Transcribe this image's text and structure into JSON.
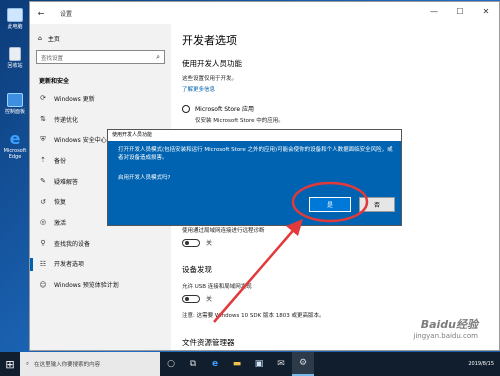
{
  "desktop": {
    "icons": [
      {
        "label": "此电脑"
      },
      {
        "label": "回收站"
      },
      {
        "label": "控制面板"
      },
      {
        "label": "Microsoft Edge"
      }
    ]
  },
  "window": {
    "title": "设置",
    "controls": {
      "minimize": "—",
      "maximize": "☐",
      "close": "✕"
    }
  },
  "sidebar": {
    "home_label": "主页",
    "search_placeholder": "查找设置",
    "section_title": "更新和安全",
    "items": [
      {
        "label": "Windows 更新",
        "icon": "sync-icon"
      },
      {
        "label": "传递优化",
        "icon": "delivery-icon"
      },
      {
        "label": "Windows 安全中心",
        "icon": "shield-icon"
      },
      {
        "label": "备份",
        "icon": "backup-icon"
      },
      {
        "label": "疑难解答",
        "icon": "wrench-icon"
      },
      {
        "label": "恢复",
        "icon": "recovery-icon"
      },
      {
        "label": "激活",
        "icon": "activation-icon"
      },
      {
        "label": "查找我的设备",
        "icon": "find-device-icon"
      },
      {
        "label": "开发者选项",
        "icon": "developer-icon",
        "active": true
      },
      {
        "label": "Windows 预览体验计划",
        "icon": "insider-icon"
      }
    ]
  },
  "main": {
    "page_title": "开发者选项",
    "dev_features_heading": "使用开发人员功能",
    "dev_features_desc": "这些设置仅用于开发。",
    "learn_more": "了解更多信息",
    "option_store_label": "Microsoft Store 应用",
    "option_store_desc": "仅安装 Microsoft Store 中的应用。",
    "remote_desc": "使用通过局域网连接进行远程诊断",
    "toggle_remote_state": "关",
    "device_discovery_heading": "设备发现",
    "device_discovery_desc": "允许 USB 连接和局域网发现",
    "toggle_discovery_state": "关",
    "note": "注意: 这需要 Windows 10 SDK 版本 1803 或更高版本。",
    "file_explorer_heading": "文件资源管理器"
  },
  "dialog": {
    "title": "使用开发人员功能",
    "message": "打开开发人员模式(包括安装和运行 Microsoft Store 之外的应用)可能会使你的设备和个人数据面临安全风险，或者对设备造成损害。",
    "question": "启用开发人员模式吗?",
    "yes_label": "是",
    "no_label": "否"
  },
  "annotation": {
    "color": "#e23a3a"
  },
  "watermark": {
    "line1": "Baidu经验",
    "line2": "jingyan.baidu.com"
  },
  "taskbar": {
    "search_placeholder": "在这里输入你要搜索的内容",
    "date": "2019/8/15",
    "pinned": [
      "task-view-icon",
      "edge-icon",
      "folder-icon",
      "store-icon",
      "mail-icon",
      "settings-icon"
    ]
  }
}
